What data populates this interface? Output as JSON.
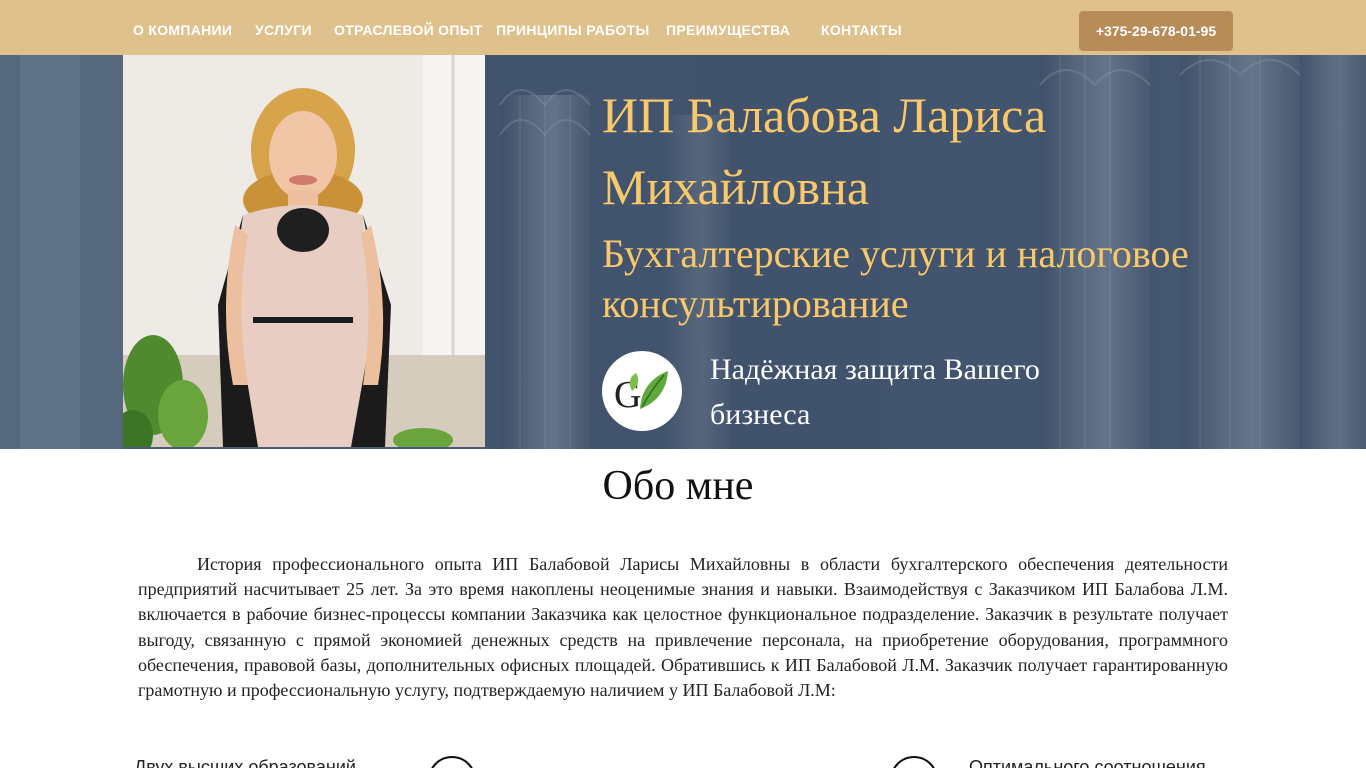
{
  "nav": {
    "items": [
      {
        "label": "О КОМПАНИИ"
      },
      {
        "label": "УСЛУГИ"
      },
      {
        "label": "ОТРАСЛЕВОЙ ОПЫТ"
      },
      {
        "label": "ПРИНЦИПЫ РАБОТЫ"
      },
      {
        "label": "ПРЕИМУЩЕСТВА"
      },
      {
        "label": "КОНТАКТЫ"
      }
    ],
    "phone": "+375-29-678-01-95"
  },
  "hero": {
    "title": "ИП Балабова Лариса Михайловна",
    "subtitle": "Бухгалтерские услуги и налоговое консультирование",
    "tagline": "Надёжная защита Вашего бизнеса",
    "logo_letter": "G"
  },
  "about": {
    "title": "Обо мне",
    "text": "История профессионального опыта  ИП Балабовой Ларисы Михайловны в области бухгалтерского обеспечения деятельности предприятий насчитывает 25 лет.  За это время накоплены неоценимые знания и навыки. Взаимодействуя с Заказчиком ИП Балабова Л.М. включается в рабочие бизнес-процессы компании Заказчика как целостное функциональное подразделение. Заказчик в результате получает выгоду, связанную с прямой экономией денежных средств на привлечение персонала, на приобретение оборудования, программного обеспечения, правовой базы, дополнительных офисных площадей. Обратившись к ИП Балабовой Л.М. Заказчик получает гарантированную грамотную и профессиональную услугу, подтверждаемую наличием у ИП Балабовой Л.М:"
  },
  "features": [
    {
      "text": "Двух высших образований"
    },
    {
      "text": "Оптимального соотношения"
    }
  ],
  "colors": {
    "nav_bg": "#dec18d",
    "accent": "#b88c58",
    "hero_title": "#f8c86a"
  }
}
